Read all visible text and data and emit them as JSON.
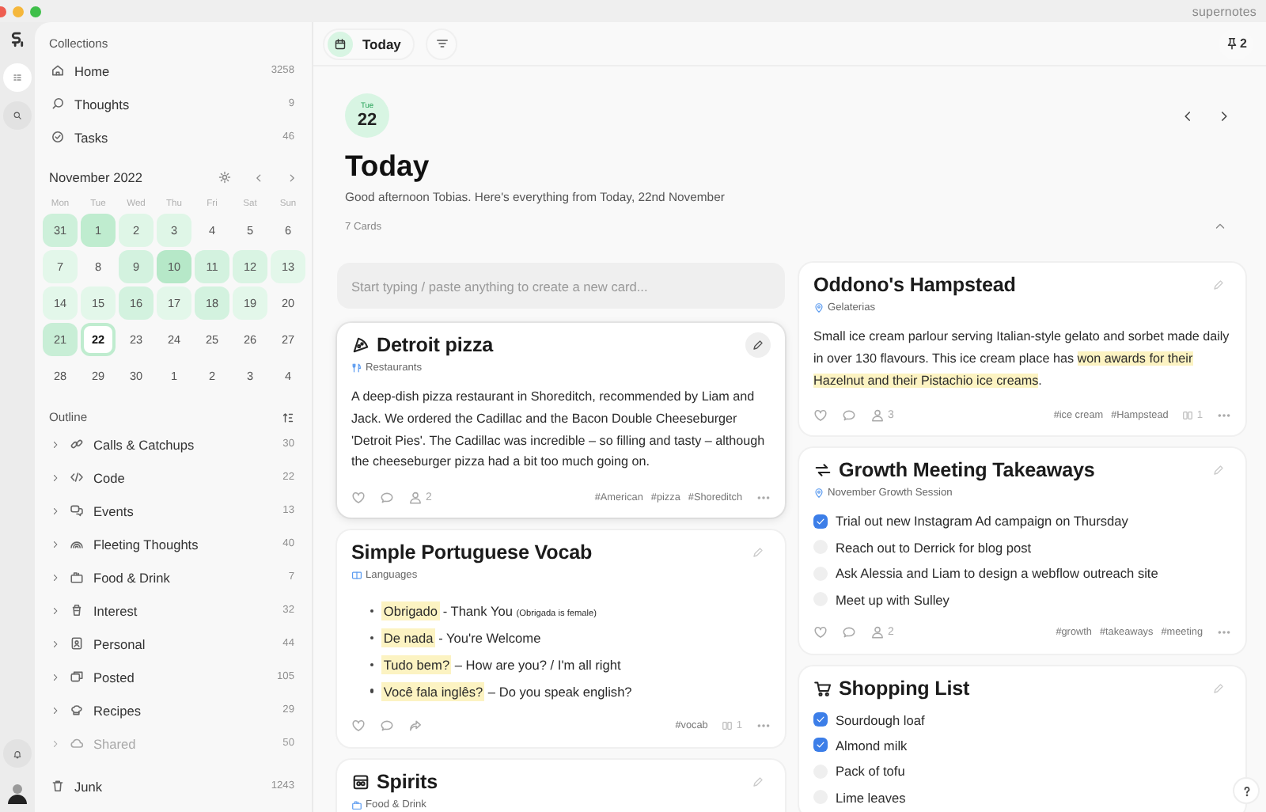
{
  "app": {
    "title": "supernotes"
  },
  "sidebar": {
    "collections_label": "Collections",
    "collections": [
      {
        "label": "Home",
        "count": "3258"
      },
      {
        "label": "Thoughts",
        "count": "9"
      },
      {
        "label": "Tasks",
        "count": "46"
      }
    ],
    "calendar": {
      "month": "November 2022",
      "weekdays": [
        "Mon",
        "Tue",
        "Wed",
        "Thu",
        "Fri",
        "Sat",
        "Sun"
      ],
      "weeks": [
        {
          "days": [
            {
              "day": "31",
              "selected": false,
              "color": "#cdf0da"
            },
            {
              "day": "1",
              "selected": false,
              "color": "#bfeccf"
            },
            {
              "day": "2",
              "selected": false,
              "color": "#dff6e7"
            },
            {
              "day": "3",
              "selected": false,
              "color": "#dff6e7"
            },
            {
              "day": "4",
              "selected": false
            },
            {
              "day": "5",
              "selected": false
            },
            {
              "day": "6",
              "selected": false
            }
          ]
        },
        {
          "days": [
            {
              "day": "7",
              "selected": false,
              "color": "#e3f7ea"
            },
            {
              "day": "8",
              "selected": false
            },
            {
              "day": "9",
              "selected": false,
              "color": "#d3f2df"
            },
            {
              "day": "10",
              "selected": false,
              "color": "#b6e8c8"
            },
            {
              "day": "11",
              "selected": false,
              "color": "#d3f2df"
            },
            {
              "day": "12",
              "selected": false,
              "color": "#d9f4e3"
            },
            {
              "day": "13",
              "selected": false,
              "color": "#e3f7ea"
            }
          ]
        },
        {
          "days": [
            {
              "day": "14",
              "selected": false,
              "color": "#e3f7ea"
            },
            {
              "day": "15",
              "selected": false,
              "color": "#e3f7ea"
            },
            {
              "day": "16",
              "selected": false,
              "color": "#d3f2df"
            },
            {
              "day": "17",
              "selected": false,
              "color": "#e3f7ea"
            },
            {
              "day": "18",
              "selected": false,
              "color": "#d3f2df"
            },
            {
              "day": "19",
              "selected": false,
              "color": "#e3f7ea"
            },
            {
              "day": "20",
              "selected": false
            }
          ]
        },
        {
          "days": [
            {
              "day": "21",
              "selected": false,
              "color": "#c8eed6"
            },
            {
              "day": "22",
              "selected": true
            },
            {
              "day": "23",
              "selected": false
            },
            {
              "day": "24",
              "selected": false
            },
            {
              "day": "25",
              "selected": false
            },
            {
              "day": "26",
              "selected": false
            },
            {
              "day": "27",
              "selected": false
            }
          ]
        },
        {
          "days": [
            {
              "day": "28",
              "selected": false
            },
            {
              "day": "29",
              "selected": false
            },
            {
              "day": "30",
              "selected": false
            },
            {
              "day": "1",
              "selected": false
            },
            {
              "day": "2",
              "selected": false
            },
            {
              "day": "3",
              "selected": false
            },
            {
              "day": "4",
              "selected": false
            }
          ]
        }
      ]
    },
    "outline_label": "Outline",
    "outline": [
      {
        "label": "Calls & Catchups",
        "count": "30",
        "expanded": false,
        "disabled": false
      },
      {
        "label": "Code",
        "count": "22",
        "expanded": false,
        "disabled": false
      },
      {
        "label": "Events",
        "count": "13",
        "expanded": false,
        "disabled": false
      },
      {
        "label": "Fleeting Thoughts",
        "count": "40",
        "expanded": false,
        "disabled": false
      },
      {
        "label": "Food & Drink",
        "count": "7",
        "expanded": false,
        "disabled": false
      },
      {
        "label": "Interest",
        "count": "32",
        "expanded": false,
        "disabled": false
      },
      {
        "label": "Personal",
        "count": "44",
        "expanded": false,
        "disabled": false
      },
      {
        "label": "Posted",
        "count": "105",
        "expanded": false,
        "disabled": false
      },
      {
        "label": "Recipes",
        "count": "29",
        "expanded": false,
        "disabled": false
      },
      {
        "label": "Shared",
        "count": "50",
        "expanded": false,
        "disabled": true
      }
    ],
    "junk": {
      "label": "Junk",
      "count": "1243"
    }
  },
  "toolbar": {
    "view": "Today",
    "pinned": "2"
  },
  "header": {
    "weekday": "Tue",
    "day": "22",
    "title": "Today",
    "greeting": "Good afternoon Tobias. Here's everything from Today, 22nd November",
    "card_count": "7 Cards"
  },
  "composer": {
    "placeholder": "Start typing / paste anything to create a new card..."
  },
  "columns": [
    {
      "cards": [
        {
          "kind": "text",
          "hovered": true,
          "title": "Detroit pizza",
          "category": "Restaurants",
          "body": [
            {
              "text": "A deep-dish pizza restaurant in Shoreditch, recommended by Liam and Jack. We ordered the Cadillac and the Bacon Double Cheeseburger 'Detroit Pies'. The Cadillac was incredible – so filling and tasty – although the cheeseburger pizza had a bit too much going on.",
              "highlighted": false
            }
          ],
          "footer": {
            "people": "2",
            "tags": [
              "#American",
              "#pizza",
              "#Shoreditch"
            ]
          }
        },
        {
          "kind": "vocab",
          "hovered": false,
          "title": "Simple Portuguese Vocab",
          "category": "Languages",
          "items": [
            {
              "term": "Obrigado",
              "meaning": "- Thank You",
              "note": "(Obrigada is female)"
            },
            {
              "term": "De nada",
              "meaning": "- You're Welcome"
            },
            {
              "term": "Tudo bem?",
              "meaning": "– How are you? / I'm all right"
            },
            {
              "term": "Você fala inglês?",
              "meaning": "– Do you speak english?"
            }
          ],
          "footer": {
            "tags": [
              "#vocab"
            ],
            "links": "1"
          }
        },
        {
          "kind": "text",
          "hovered": false,
          "title": "Spirits",
          "category": "Food & Drink"
        }
      ]
    },
    {
      "cards": [
        {
          "kind": "text",
          "hovered": false,
          "title": "Oddono's Hampstead",
          "category": "Gelaterias",
          "body": [
            {
              "text": "Small ice cream parlour serving Italian-style gelato and sorbet made daily in over 130 flavours. This ice cream place has ",
              "highlighted": false
            },
            {
              "text": "won awards for their Hazelnut and their Pistachio ice creams",
              "highlighted": true
            },
            {
              "text": ".",
              "highlighted": false
            }
          ],
          "footer": {
            "people": "3",
            "tags": [
              "#ice cream",
              "#Hampstead"
            ],
            "links": "1"
          }
        },
        {
          "kind": "checklist",
          "hovered": false,
          "title": "Growth Meeting Takeaways",
          "category": "November Growth Session",
          "items": [
            {
              "text": "Trial out new Instagram Ad campaign on Thursday",
              "checked": true
            },
            {
              "text": "Reach out to Derrick for blog post",
              "checked": false
            },
            {
              "text": "Ask Alessia and Liam to design a webflow outreach site",
              "checked": false
            },
            {
              "text": "Meet up with Sulley",
              "checked": false
            }
          ],
          "footer": {
            "people": "2",
            "tags": [
              "#growth",
              "#takeaways",
              "#meeting"
            ]
          }
        },
        {
          "kind": "checklist",
          "hovered": false,
          "title": "Shopping List",
          "items": [
            {
              "text": "Sourdough loaf",
              "checked": true
            },
            {
              "text": "Almond milk",
              "checked": true
            },
            {
              "text": "Pack of tofu",
              "checked": false
            },
            {
              "text": "Lime leaves",
              "checked": false
            }
          ]
        }
      ]
    }
  ]
}
